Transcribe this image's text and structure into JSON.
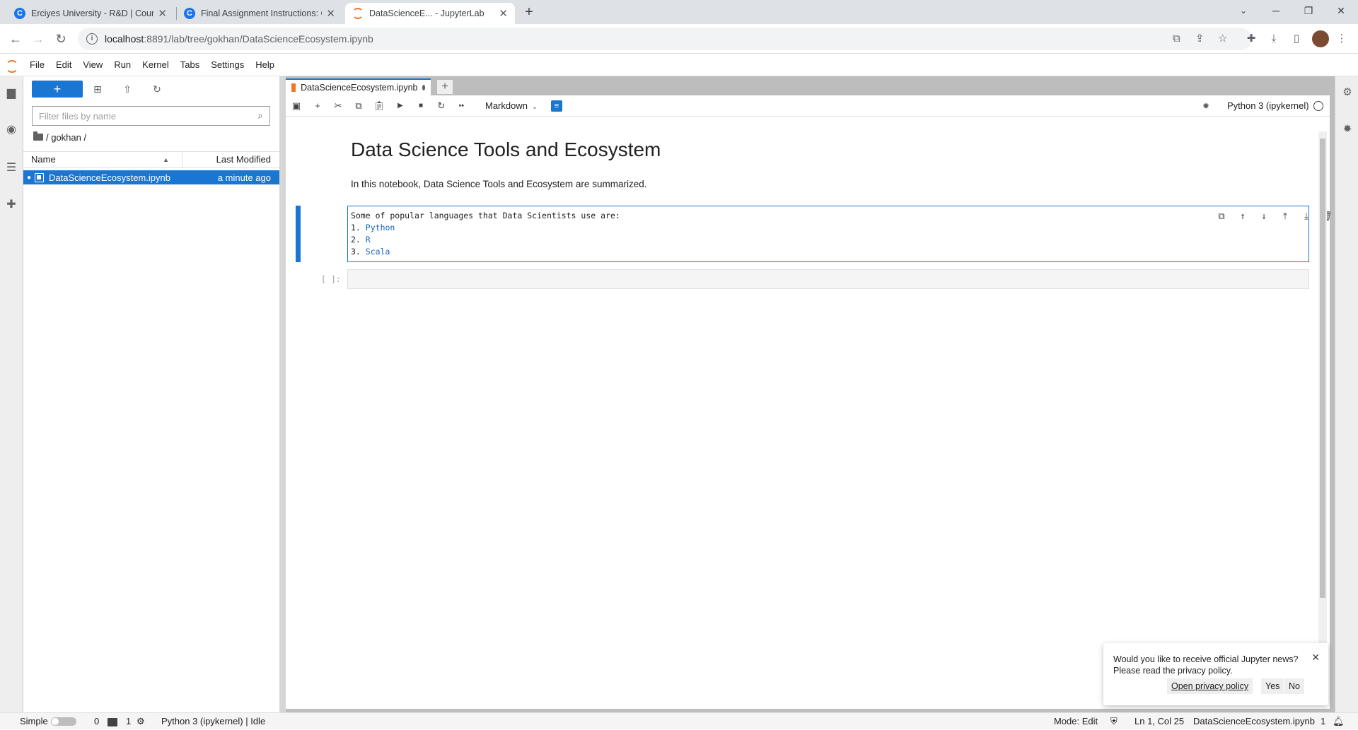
{
  "browser": {
    "tabs": [
      {
        "title": "Erciyes University - R&D | Course",
        "favicon": "coursera-icon"
      },
      {
        "title": "Final Assignment Instructions: Cr",
        "favicon": "coursera-icon"
      },
      {
        "title": "DataScienceE... - JupyterLab",
        "favicon": "jupyter-icon"
      }
    ],
    "url_host": "localhost",
    "url_path": ":8891/lab/tree/gokhan/DataScienceEcosystem.ipynb"
  },
  "menubar": {
    "items": [
      "File",
      "Edit",
      "View",
      "Run",
      "Kernel",
      "Tabs",
      "Settings",
      "Help"
    ]
  },
  "filebrowser": {
    "new_label": "+",
    "filter_placeholder": "Filter files by name",
    "breadcrumb": "/ gokhan /",
    "col_name": "Name",
    "col_modified": "Last Modified",
    "files": [
      {
        "name": "DataScienceEcosystem.ipynb",
        "modified": "a minute ago"
      }
    ]
  },
  "notebook": {
    "tab_title": "DataScienceEcosystem.ipynb",
    "cell_type": "Markdown",
    "kernel": "Python 3 (ipykernel)",
    "heading": "Data Science Tools and Ecosystem",
    "intro": "In this notebook, Data Science Tools and Ecosystem are summarized.",
    "edit_cell": {
      "line1": "Some of popular languages that Data Scientists use are:",
      "items": [
        {
          "num": "1.",
          "text": "Python"
        },
        {
          "num": "2.",
          "text": "R"
        },
        {
          "num": "3.",
          "text": "Scala"
        }
      ]
    },
    "code_prompt": "[ ]:"
  },
  "toast": {
    "line1": "Would you like to receive official Jupyter news?",
    "line2": "Please read the privacy policy.",
    "open_policy": "Open privacy policy",
    "yes": "Yes",
    "no": "No"
  },
  "statusbar": {
    "mode_label": "Simple",
    "terminals": "0",
    "kernels": "1",
    "kernel_status": "Python 3 (ipykernel) | Idle",
    "mode": "Mode: Edit",
    "cursor": "Ln 1, Col 25",
    "filename": "DataScienceEcosystem.ipynb",
    "notifications": "1"
  },
  "colors": {
    "accent": "#1976d2",
    "jupyter_orange": "#f37726"
  }
}
